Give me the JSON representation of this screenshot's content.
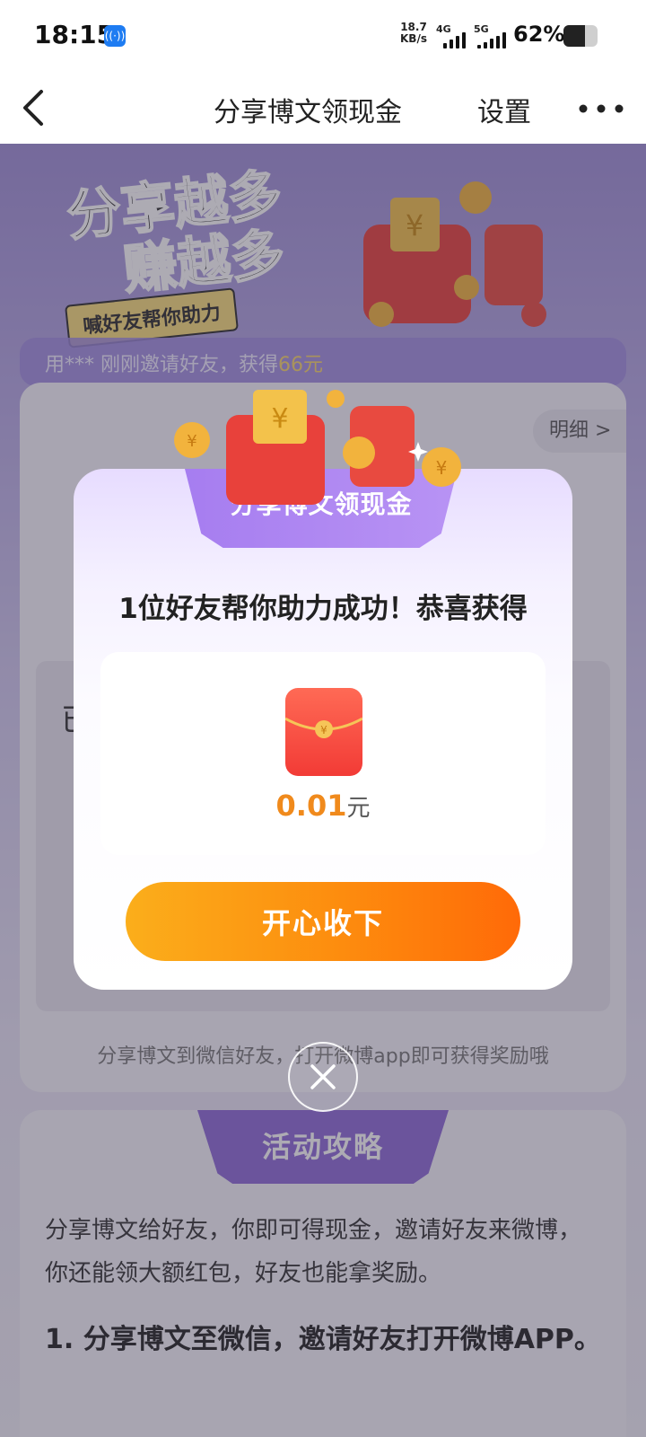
{
  "status_bar": {
    "time": "18:15",
    "net_speed_value": "18.7",
    "net_speed_unit": "KB/s",
    "net1": "4G",
    "net2": "5G",
    "battery_text": "62%",
    "battery_level": 0.62
  },
  "nav": {
    "back_icon": "chevron-left-icon",
    "title": "分享博文领现金",
    "settings_label": "设置",
    "more_icon": "more-dots-icon"
  },
  "page": {
    "hero_line1": "分享越多",
    "hero_line2": "赚越多",
    "hero_sub": "喊好友帮你助力",
    "ticker_prefix": "用*** 刚刚邀请好友，获得",
    "ticker_amount": "66元",
    "detail_label": "明细 >",
    "partial_text": "已",
    "share_tip": "分享博文到微信好友，打开微博app即可获得奖励哦",
    "strategy_title": "活动攻略",
    "strategy_p1": "分享博文给好友，你即可得现金，邀请好友来微博，你还能领大额红包，好友也能拿奖励。",
    "strategy_step1": "1. 分享博文至微信，邀请好友打开微博APP。"
  },
  "modal": {
    "tab_title": "分享博文领现金",
    "heading": "1位好友帮你助力成功！恭喜获得",
    "amount": "0.01",
    "unit": "元",
    "accept_label": "开心收下",
    "close_icon": "close-icon"
  },
  "colors": {
    "accent_orange": "#f08a1c",
    "purple": "#a67df0"
  }
}
